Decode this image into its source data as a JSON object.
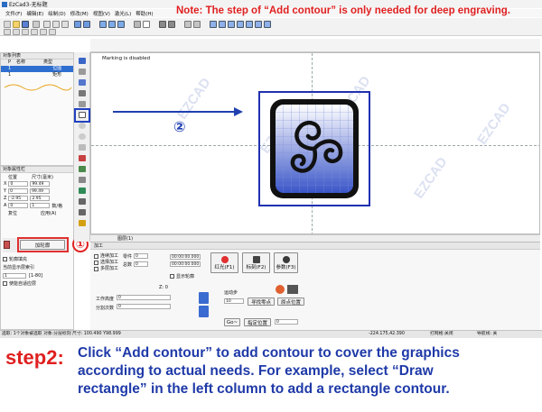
{
  "window": {
    "title": "EzCad3-无标题"
  },
  "menu": [
    "文件(F)",
    "编辑(E)",
    "绘制(D)",
    "修改(M)",
    "视图(V)",
    "激光(L)",
    "帮助(H)"
  ],
  "note": "Note: The step of “Add contour” is only needed for deep engraving.",
  "object_list": {
    "title": "对象列表",
    "headers": [
      "P",
      "名称",
      "类型"
    ],
    "rows": [
      {
        "p": "1",
        "name": "",
        "type": "位图",
        "selected": true
      },
      {
        "p": "1",
        "name": "",
        "type": "矩形",
        "selected": false
      }
    ]
  },
  "properties": {
    "title": "对象属性栏",
    "col_position": "位置",
    "col_size": "尺寸(毫米)",
    "rows": [
      {
        "label": "X",
        "pos": "0",
        "size": "99.49"
      },
      {
        "label": "Y",
        "pos": "0",
        "size": "99.49"
      },
      {
        "label": "Z",
        "pos": "-2.95",
        "size": "2.95"
      },
      {
        "label": "A",
        "pos": "0",
        "size": "1"
      }
    ],
    "unit_label": "数/格",
    "apply_label": "应用(A)",
    "reset_label": "复位",
    "add_contour_button": "加轮廓",
    "option1": "轮廓填充",
    "option2": "当前显示层索引",
    "range_value": "1",
    "range_hint": "[1-80]",
    "option3": "使能自适应层"
  },
  "canvas": {
    "status_text": "Marking is disabled",
    "step_number": "②",
    "watermark": "EZCAD"
  },
  "bottom_tab": "图层(1)",
  "marking": {
    "title": "加工",
    "check1": "连续加工",
    "check2": "选择加工",
    "check3": "多层加工",
    "parts_label": "零件",
    "total_label": "总数",
    "parts_value": "0",
    "total_value": "0",
    "time1": "00:00:00.000",
    "time2": "00:00:00.000",
    "show_contour": "显示轮廓",
    "red_light": "红光(F1)",
    "mark_btn": "标刻(F2)",
    "param_btn": "参数(F3)",
    "z_label": "Z:",
    "z_value": "0",
    "work_height": "工作高度",
    "work_value": "0",
    "split_count": "分割次数",
    "split_value": "0",
    "motion_label": "运动步",
    "motion_value": "10",
    "find_zero": "寻找零点",
    "back_zero": "原点位置",
    "goto_label": "Go~",
    "goto_btn": "指定位置",
    "goto_value": "0"
  },
  "status": {
    "left": "选取: 1个对象被选取 对象:分层标刻 尺寸: 100.490 Y98.999",
    "coords": "-224.175,42.390",
    "grid": "打网格:关闭",
    "guide": "导航线: 关"
  },
  "step": {
    "label": "step2:",
    "marker": "①",
    "lines": [
      "Click “Add contour” to add contour to cover the graphics",
      "according to actual needs. For example, select “Draw",
      "rectangle” in the left column to add a rectangle contour."
    ]
  }
}
